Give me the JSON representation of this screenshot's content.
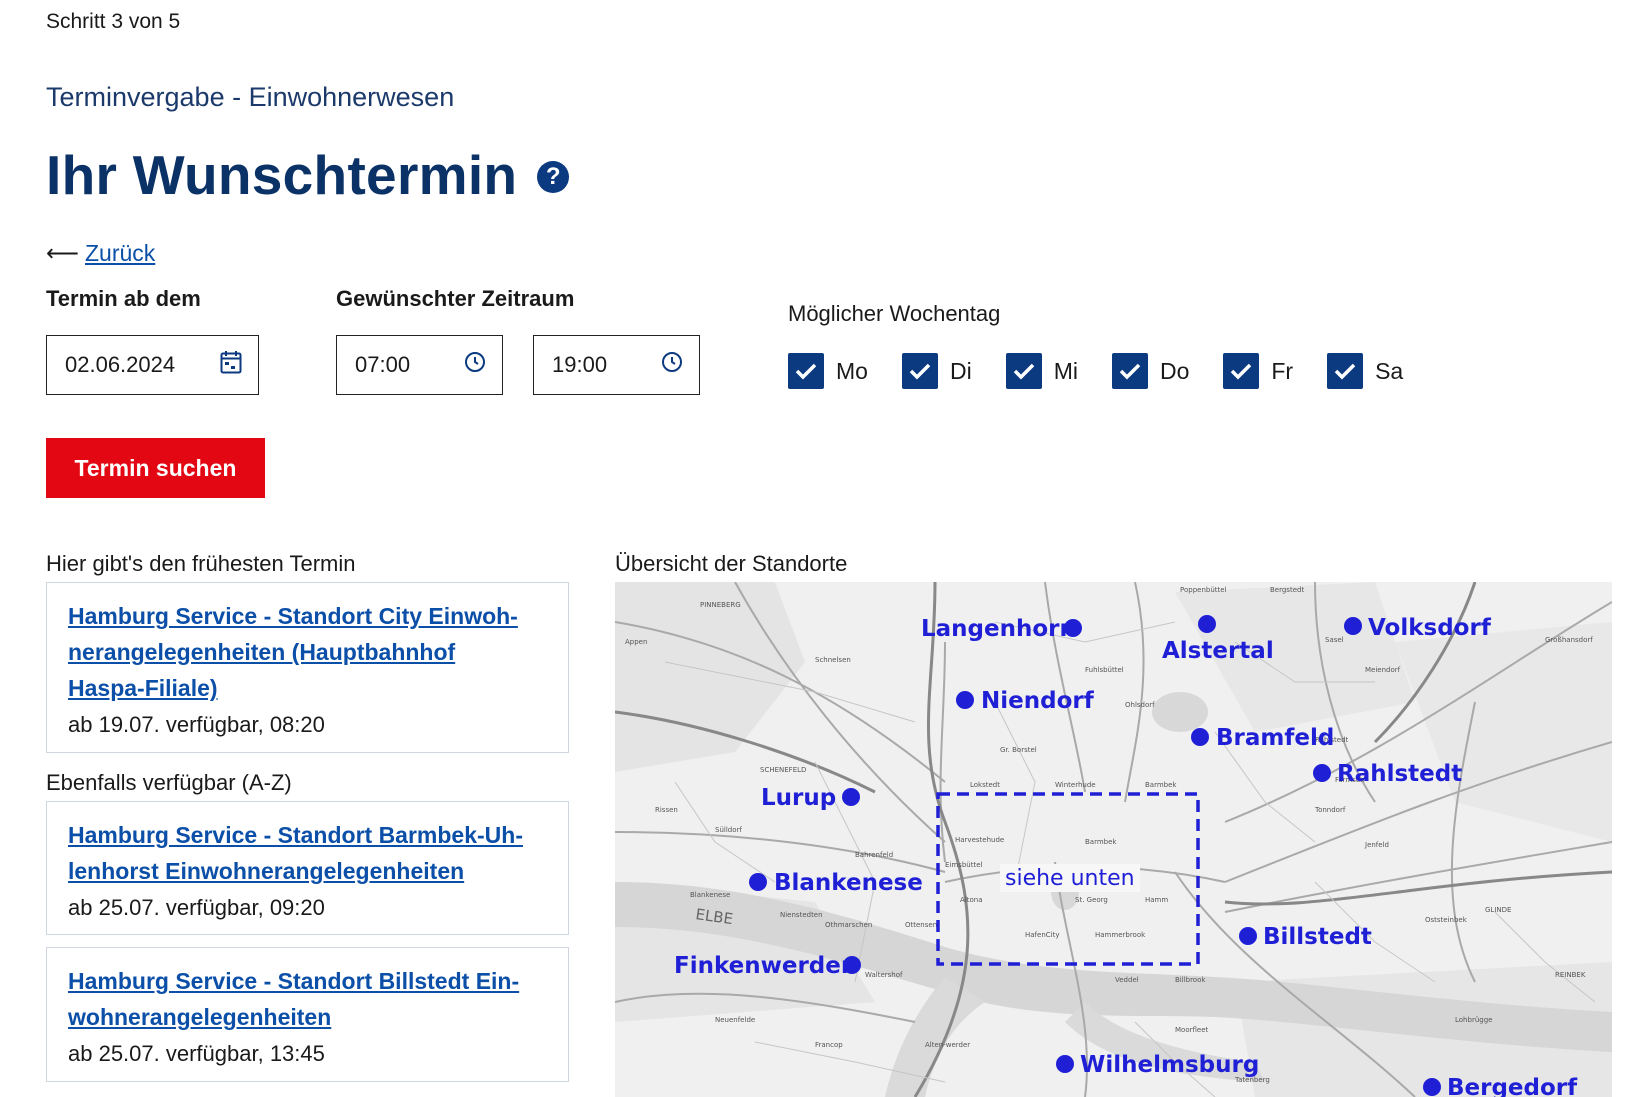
{
  "step": "Schritt 3 von 5",
  "subtitle": "Terminvergabe - Einwohnerwesen",
  "title": "Ihr Wunschtermin",
  "back_label": "Zurück",
  "form": {
    "date_label": "Termin ab dem",
    "date_value": "02.06.2024",
    "time_label": "Gewünschter Zeitraum",
    "time_from": "07:00",
    "time_to": "19:00",
    "weekday_label": "Möglicher Wochentag",
    "weekdays": [
      {
        "label": "Mo",
        "checked": true
      },
      {
        "label": "Di",
        "checked": true
      },
      {
        "label": "Mi",
        "checked": true
      },
      {
        "label": "Do",
        "checked": true
      },
      {
        "label": "Fr",
        "checked": true
      },
      {
        "label": "Sa",
        "checked": true
      }
    ],
    "search_button": "Termin suchen"
  },
  "earliest": {
    "heading": "Hier gibt's den frühesten Termin",
    "items": [
      {
        "lines": [
          "Hamburg Service - Standort City Einwoh-",
          "nerangelegenheiten (Hauptbahnhof",
          "Haspa-Filiale)"
        ],
        "availability": "ab 19.07. verfügbar, 08:20"
      }
    ]
  },
  "also": {
    "heading": "Ebenfalls verfügbar (A-Z)",
    "items": [
      {
        "lines": [
          "Hamburg Service - Standort Barmbek-Uh-",
          "lenhorst Einwohnerangelegenheiten"
        ],
        "availability": "ab 25.07. verfügbar, 09:20"
      },
      {
        "lines": [
          "Hamburg Service - Standort Billstedt Ein-",
          "wohnerangelegenheiten"
        ],
        "availability": "ab 25.07. verfügbar, 13:45"
      }
    ]
  },
  "map": {
    "heading": "Übersicht der Standorte",
    "marker_color": "#1f1fd6",
    "locations": [
      "Langenhorn",
      "Alstertal",
      "Volksdorf",
      "Niendorf",
      "Bramfeld",
      "Rahlstedt",
      "Lurup",
      "Blankenese",
      "Billstedt",
      "Finkenwerder",
      "Wilhelmsburg",
      "Bergedorf"
    ],
    "center_label": "siehe unten",
    "river_label": "ELBE"
  },
  "colors": {
    "brand_blue": "#0b3266",
    "link": "#0b4fa8",
    "button_red": "#e30613",
    "checkbox": "#0b3a80"
  }
}
